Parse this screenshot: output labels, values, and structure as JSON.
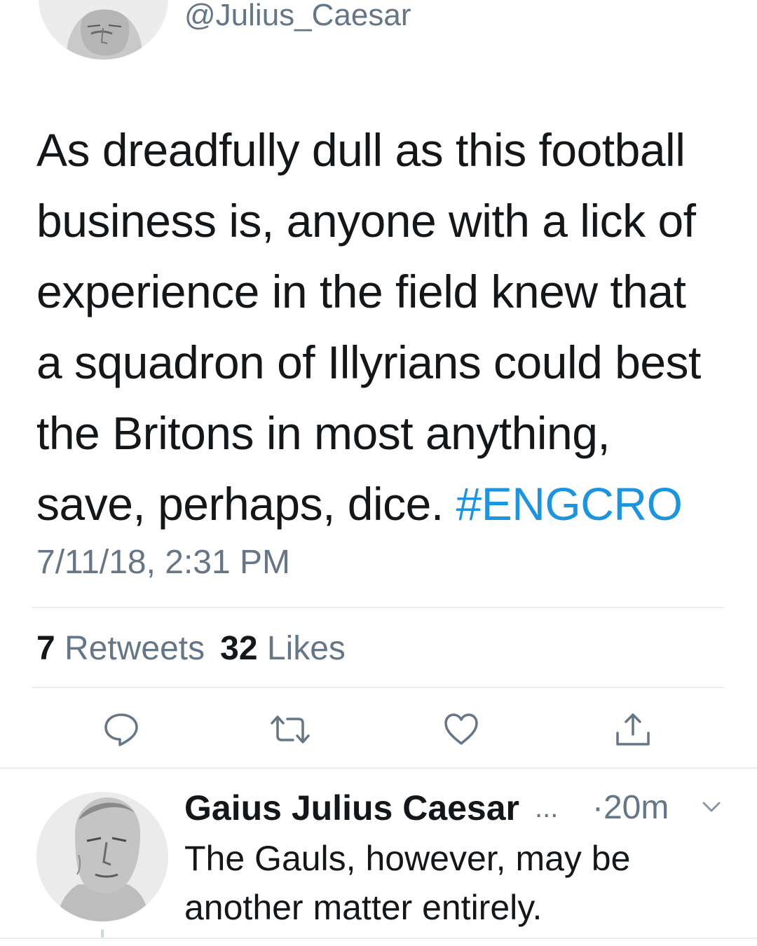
{
  "tweet": {
    "handle": "@Julius_Caesar",
    "text_lines": [
      "As dreadfully dull as this football",
      "business is, anyone with a lick of",
      "experience in the field knew that",
      "a squadron of Illyrians could best",
      "the Britons in most anything,",
      "save, perhaps, dice. "
    ],
    "hashtag": "#ENGCRO",
    "timestamp": "7/11/18, 2:31 PM",
    "retweets_count": "7",
    "retweets_label": "Retweets",
    "likes_count": "32",
    "likes_label": "Likes"
  },
  "actions": {
    "reply_icon": "comment-icon",
    "retweet_icon": "retweet-icon",
    "like_icon": "heart-icon",
    "share_icon": "share-icon"
  },
  "reply": {
    "name": "Gaius Julius Caesar",
    "ellipsis": "...",
    "time": "·20m",
    "text_lines": [
      "The Gauls, however, may be",
      "another matter entirely."
    ]
  },
  "colors": {
    "text": "#14171a",
    "secondary": "#657786",
    "link": "#1b95e0",
    "divider": "#e6ecf0"
  }
}
